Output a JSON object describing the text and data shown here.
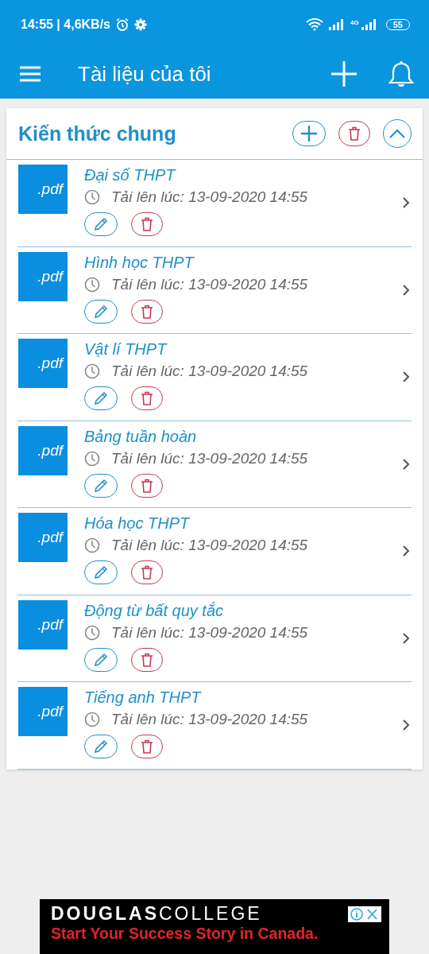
{
  "status_bar": {
    "time_speed": "14:55 | 4,6KB/s",
    "network": "4G",
    "battery": "55"
  },
  "app_bar": {
    "title": "Tài liệu của tôi"
  },
  "section": {
    "title": "Kiến thức chung",
    "expanded": true,
    "documents": [
      {
        "name": "Đại số THPT",
        "file_type": ".pdf",
        "uploaded": "Tải lên lúc: 13-09-2020 14:55"
      },
      {
        "name": "Hình học THPT",
        "file_type": ".pdf",
        "uploaded": "Tải lên lúc: 13-09-2020 14:55"
      },
      {
        "name": "Vật lí THPT",
        "file_type": ".pdf",
        "uploaded": "Tải lên lúc: 13-09-2020 14:55"
      },
      {
        "name": "Bảng tuần hoàn",
        "file_type": ".pdf",
        "uploaded": "Tải lên lúc: 13-09-2020 14:55"
      },
      {
        "name": "Hóa học THPT",
        "file_type": ".pdf",
        "uploaded": "Tải lên lúc: 13-09-2020 14:55"
      },
      {
        "name": "Động từ bất quy tắc",
        "file_type": ".pdf",
        "uploaded": "Tải lên lúc: 13-09-2020 14:55"
      },
      {
        "name": "Tiếng anh THPT",
        "file_type": ".pdf",
        "uploaded": "Tải lên lúc: 13-09-2020 14:55"
      }
    ]
  },
  "ad": {
    "brand_bold": "DOUGLAS",
    "brand_light": "COLLEGE",
    "tagline": "Start Your Success Story in Canada."
  }
}
